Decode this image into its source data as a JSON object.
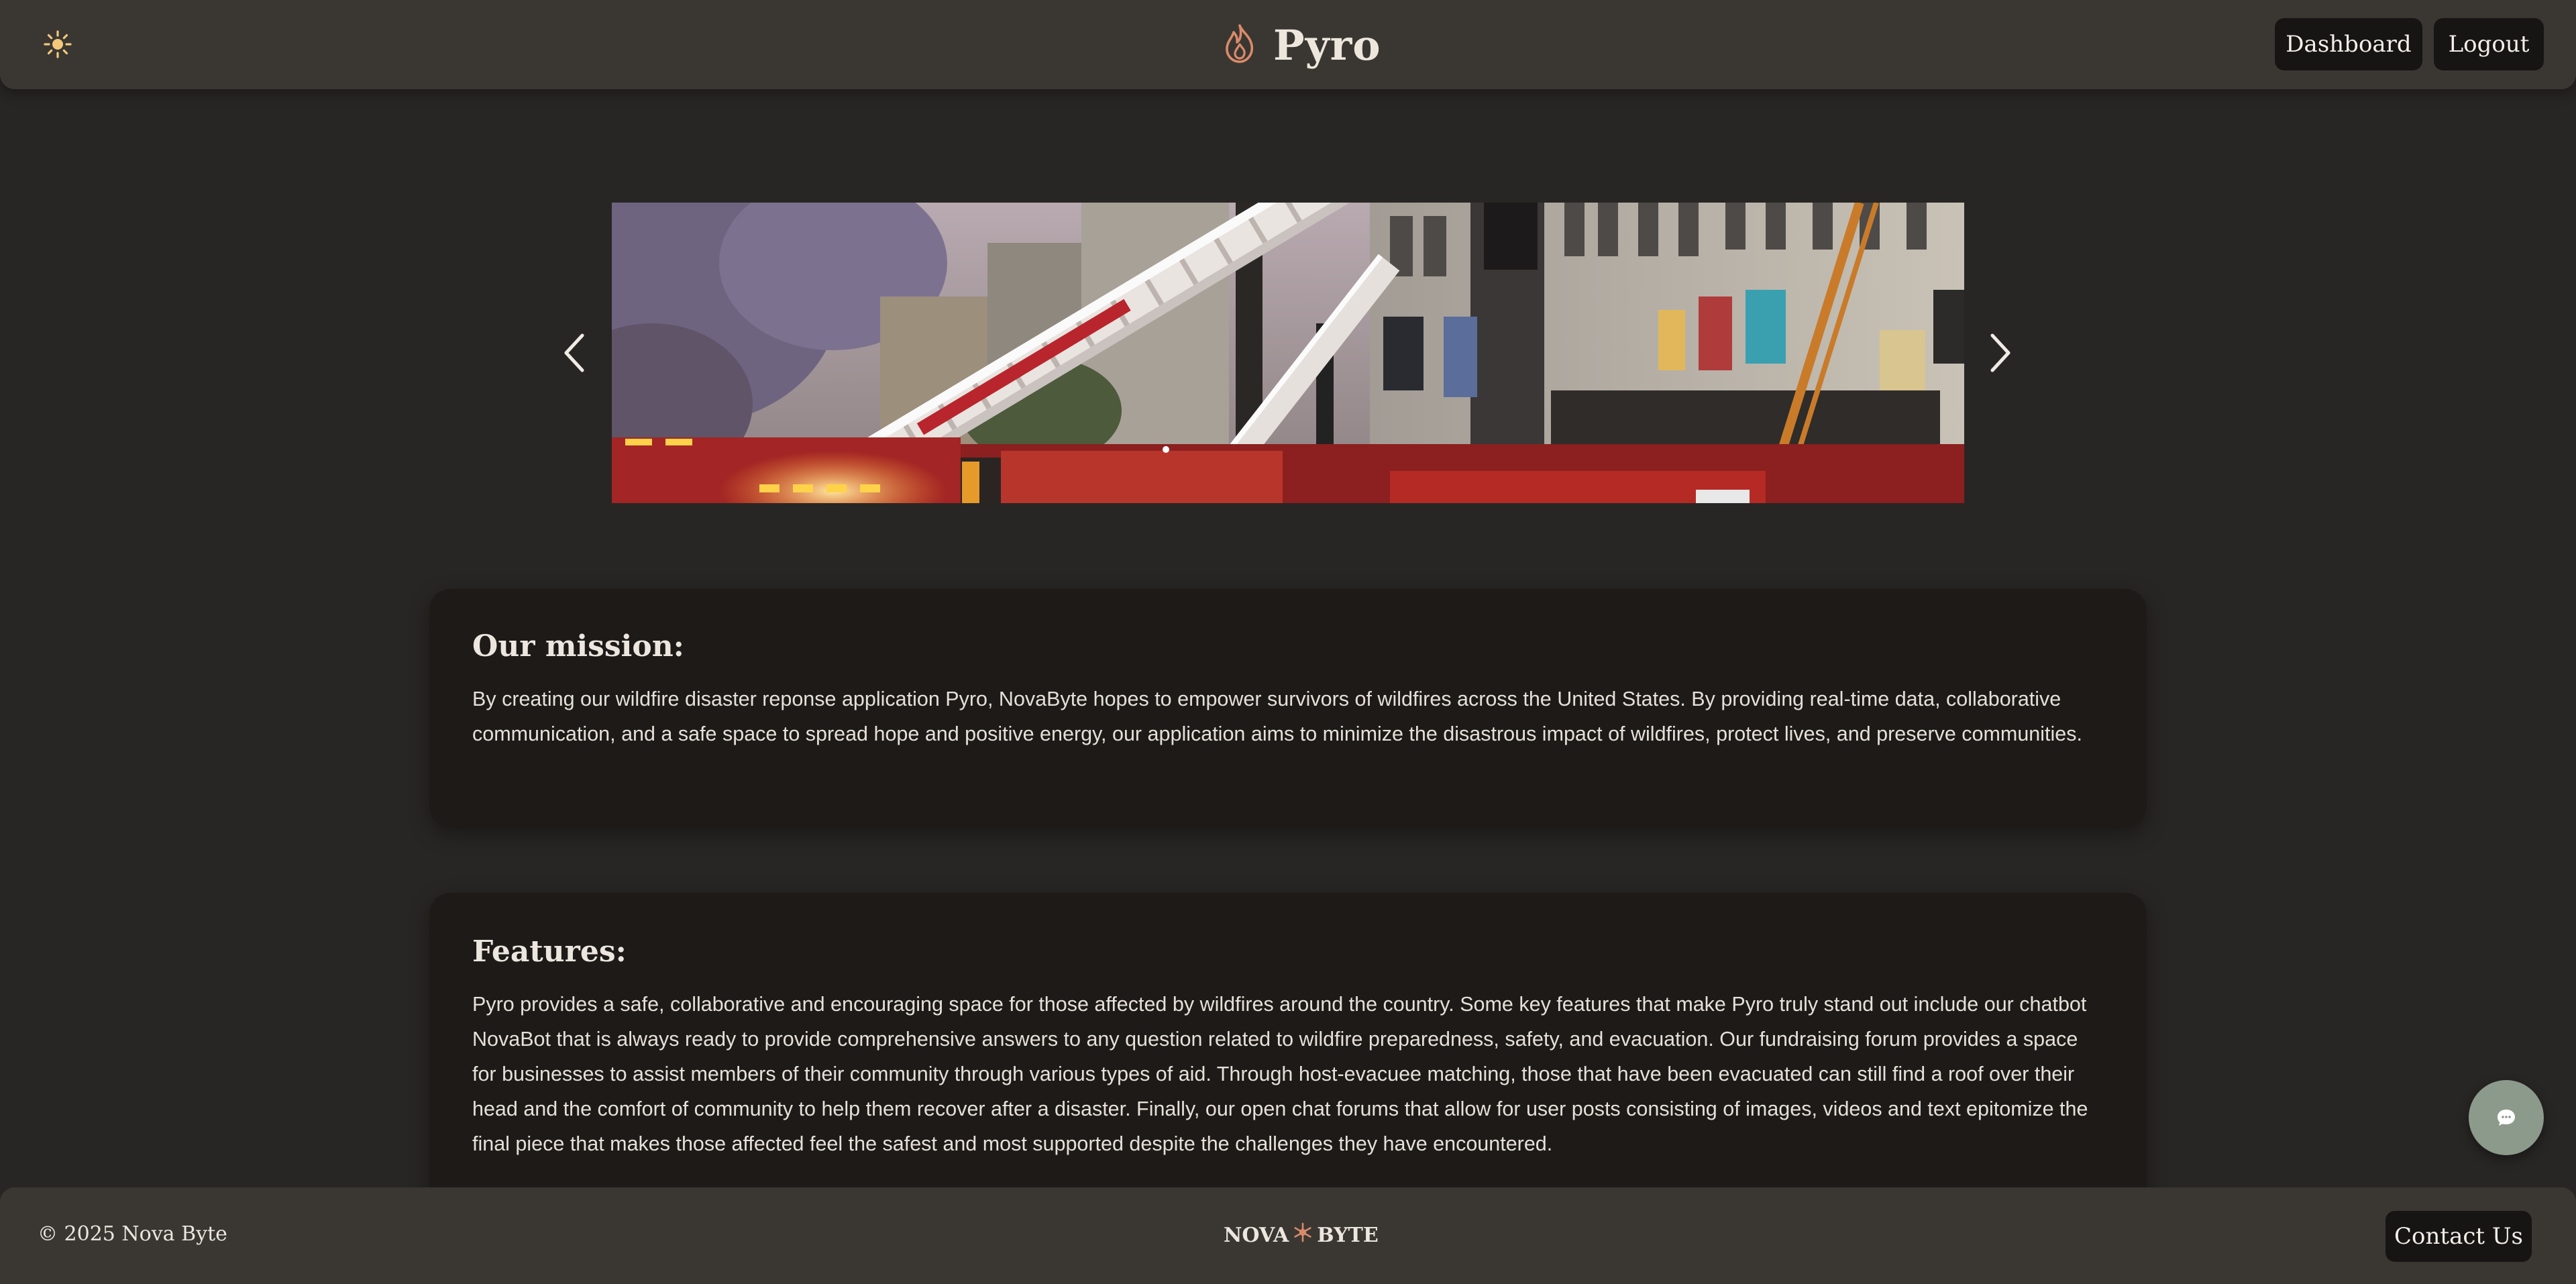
{
  "header": {
    "brand": "Pyro",
    "buttons": {
      "dashboard": "Dashboard",
      "logout": "Logout"
    },
    "icons": {
      "theme_toggle": "sun-icon",
      "brand_logo": "flame-icon"
    }
  },
  "carousel": {
    "image": "fire-trucks-ladder-photo",
    "slide_count": 2,
    "active_slide": 1,
    "icons": {
      "prev": "chevron-left-icon",
      "next": "chevron-right-icon"
    }
  },
  "mission": {
    "title": "Our mission:",
    "body": "By creating our wildfire disaster reponse application Pyro, NovaByte hopes to empower survivors of wildfires across the United States. By providing real-time data, collaborative communication, and a safe space to spread hope and positive energy, our application aims to minimize the disastrous impact of wildfires, protect lives, and preserve communities."
  },
  "features": {
    "title": "Features:",
    "body": "Pyro provides a safe, collaborative and encouraging space for those affected by wildfires around the country. Some key features that make Pyro truly stand out include our chatbot NovaBot that is always ready to provide comprehensive answers to any question related to wildfire preparedness, safety, and evacuation. Our fundraising forum provides a space for businesses to assist members of their community through various types of aid. Through host-evacuee matching, those that have been evacuated can still find a roof over their head and the comfort of community to help them recover after a disaster. Finally, our open chat forums that allow for user posts consisting of images, videos and text epitomize the final piece that makes those affected feel the safest and most supported despite the challenges they have encountered."
  },
  "chat": {
    "icon": "chat-bubble-icon"
  },
  "footer": {
    "copyright": "© 2025 Nova Byte",
    "logo_left": "NOVA",
    "logo_right": "BYTE",
    "contact": "Contact Us"
  },
  "colors": {
    "background": "#282624",
    "header": "#3a3733",
    "card": "#1d1a18",
    "accent": "#d98b6a",
    "button": "#161514",
    "chat": "#8c9a8c"
  }
}
